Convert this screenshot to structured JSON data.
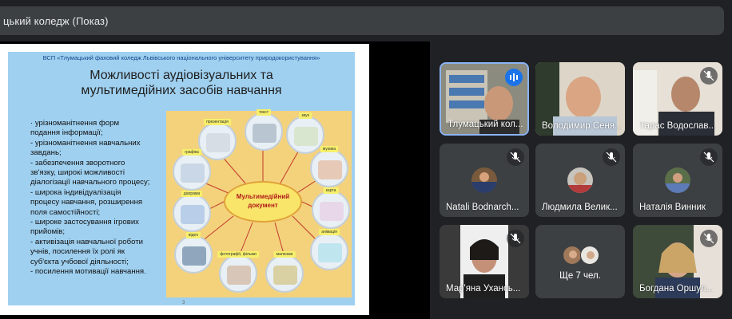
{
  "window": {
    "title": "цький коледж (Показ)"
  },
  "slide": {
    "org": "ВСП «Тлумацький фаховий коледж Львівського національного університету природокористування»",
    "title_line1": "Можливості аудіовізуальних та",
    "title_line2": "мультимедійних засобів навчання",
    "bullets": [
      "· урізноманітнення форм",
      "подання інформації;",
      "- урізноманітнення навчальних",
      "завдань;",
      "- забезпечення зворотного",
      "зв'язку, широкі можливості",
      "діалогізації навчального процесу;",
      "- широка індивідуалізація",
      "процесу навчання, розширення",
      "поля самостійності;",
      "- широке застосування ігрових",
      "прийомів;",
      "- активізація навчальної роботи",
      "учнів, посилення їх ролі як",
      "суб'єкта учбової діяльності;",
      "- посилення мотивації навчання."
    ],
    "center_line1": "Мультимедійний",
    "center_line2": "документ",
    "page_number": "3",
    "nodes": [
      "презентація",
      "текст",
      "звук",
      "музика",
      "графіка",
      "карта",
      "діаграма",
      "анімація",
      "відео",
      "фотографії, фільми",
      "малюнки"
    ]
  },
  "participants": [
    {
      "name": "Тлумацький кол...",
      "type": "video",
      "speaking": true
    },
    {
      "name": "Володимир Сеня...",
      "type": "video",
      "muted": false
    },
    {
      "name": "Тарас Водослав...",
      "type": "video",
      "muted": true
    },
    {
      "name": "Natali Bodnarch...",
      "type": "avatar",
      "muted": true
    },
    {
      "name": "Людмила Велик...",
      "type": "avatar",
      "muted": true
    },
    {
      "name": "Наталія Винник",
      "type": "avatar",
      "muted": true
    },
    {
      "name": "Мар'яна Ухансь...",
      "type": "video",
      "muted": true
    },
    {
      "name": "Ще 7 чел.",
      "type": "more"
    },
    {
      "name": "Богдана Оршул...",
      "type": "video",
      "muted": true
    }
  ],
  "icons": {
    "mic_off": "mic-off-icon",
    "speaking": "audio-level-icon"
  },
  "colors": {
    "background": "#202124",
    "tile": "#3c4043",
    "accent": "#1a73e8",
    "slide_blue": "#9fd0f0"
  }
}
